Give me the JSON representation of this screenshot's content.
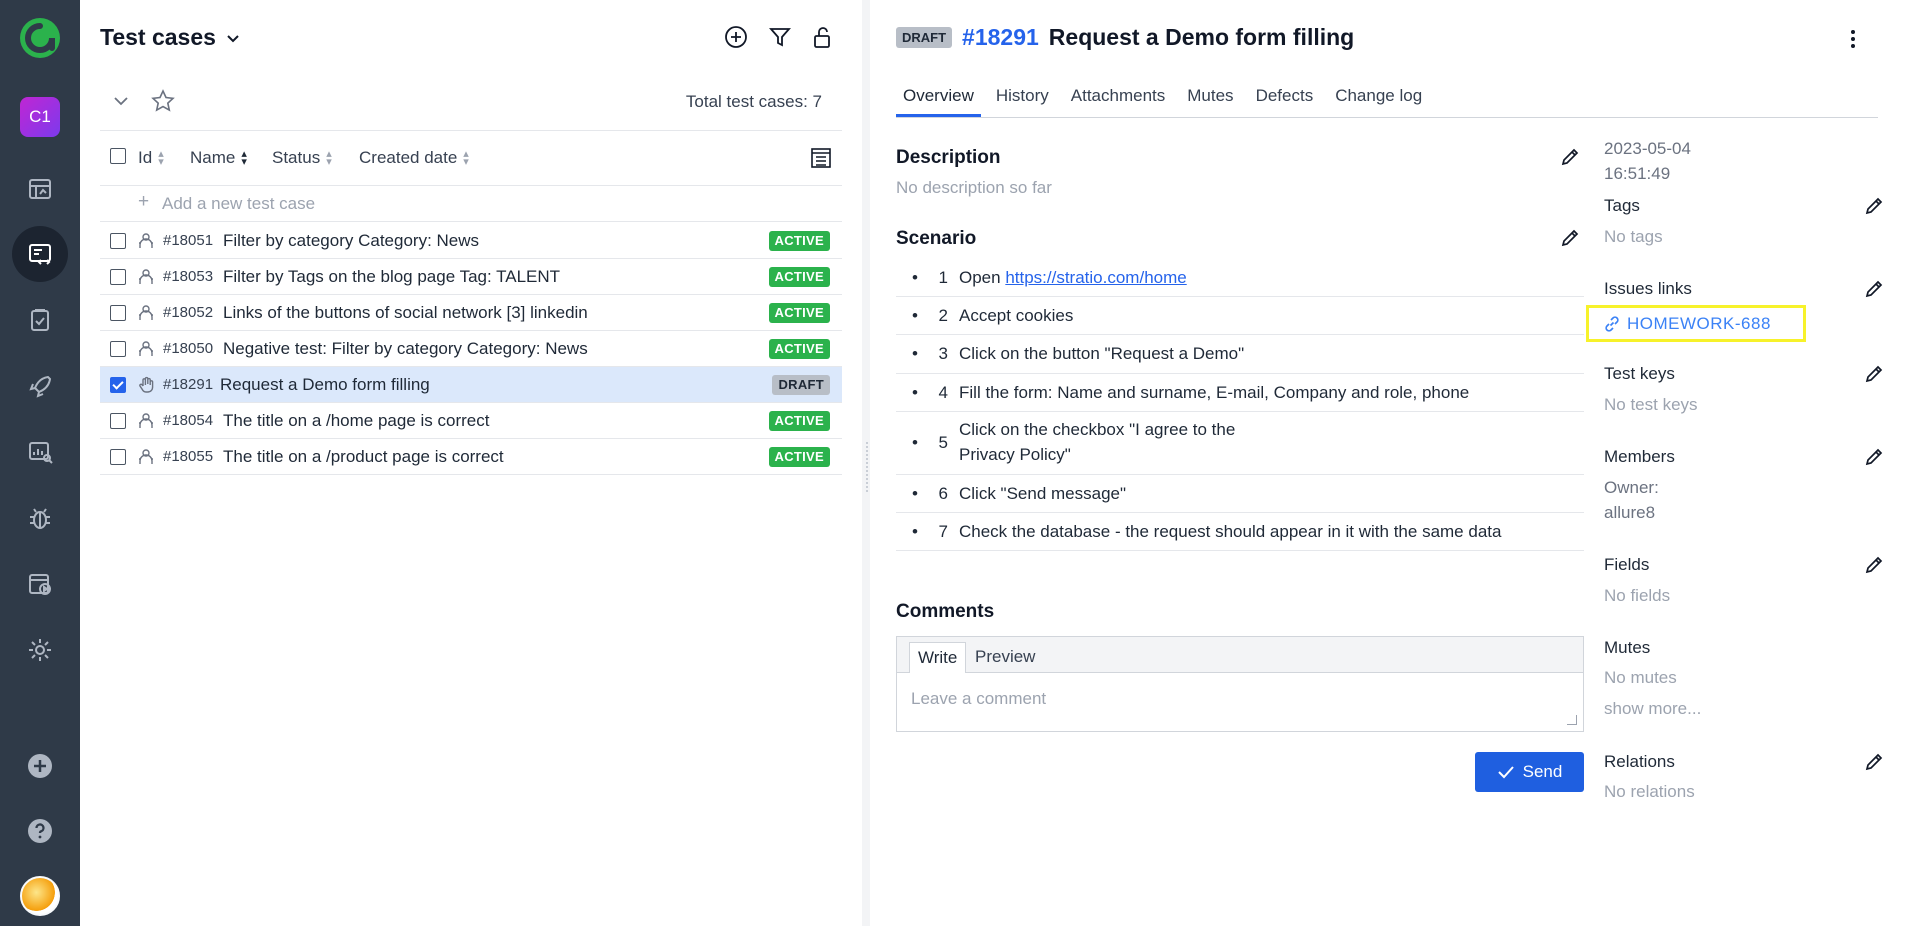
{
  "nav": {
    "project_initials": "C1",
    "items": [
      "dashboards-icon",
      "test-cases-icon",
      "test-plans-icon",
      "launches-icon",
      "analytics-icon",
      "defects-icon",
      "jobs-icon",
      "settings-icon"
    ],
    "bottom": [
      "add-icon",
      "help-icon",
      "avatar"
    ]
  },
  "list": {
    "title": "Test cases",
    "total": "Total test cases: 7",
    "columns": {
      "id": "Id",
      "name": "Name",
      "status": "Status",
      "created": "Created date"
    },
    "add_placeholder": "Add a new test case",
    "rows": [
      {
        "id": "#18051",
        "name": "Filter by category Category: News",
        "status": "ACTIVE",
        "selected": false
      },
      {
        "id": "#18053",
        "name": "Filter by Tags on the blog page Tag: TALENT",
        "status": "ACTIVE",
        "selected": false
      },
      {
        "id": "#18052",
        "name": "Links of the buttons of social network [3] linkedin",
        "status": "ACTIVE",
        "selected": false
      },
      {
        "id": "#18050",
        "name": "Negative test: Filter by category Category: News",
        "status": "ACTIVE",
        "selected": false
      },
      {
        "id": "#18291",
        "name": "Request a Demo form filling",
        "status": "DRAFT",
        "selected": true
      },
      {
        "id": "#18054",
        "name": "The title on a /home page is correct",
        "status": "ACTIVE",
        "selected": false
      },
      {
        "id": "#18055",
        "name": "The title on a /product page is correct",
        "status": "ACTIVE",
        "selected": false
      }
    ]
  },
  "detail": {
    "badge": "DRAFT",
    "number": "#18291",
    "title": "Request a Demo form filling",
    "tabs": [
      "Overview",
      "History",
      "Attachments",
      "Mutes",
      "Defects",
      "Change log"
    ],
    "active_tab": "Overview",
    "description_title": "Description",
    "description_empty": "No description so far",
    "scenario_title": "Scenario",
    "steps": [
      {
        "n": "1",
        "prefix": "Open ",
        "link": "https://stratio.com/home"
      },
      {
        "n": "2",
        "text": "Accept cookies"
      },
      {
        "n": "3",
        "text": "Click on the button \"Request a Demo\""
      },
      {
        "n": "4",
        "text": "Fill the form: Name and surname, E-mail, Company and role, phone"
      },
      {
        "n": "5",
        "text": "Click on the checkbox \"I agree to the",
        "text2": "Privacy Policy\""
      },
      {
        "n": "6",
        "text": "Click \"Send message\""
      },
      {
        "n": "7",
        "text": "Check the database - the request should appear in it with the same data"
      }
    ],
    "comments_title": "Comments",
    "comment_tabs": {
      "write": "Write",
      "preview": "Preview"
    },
    "comment_placeholder": "Leave a comment",
    "send_label": "Send"
  },
  "sidebar": {
    "date": "2023-05-04",
    "time": "16:51:49",
    "tags_title": "Tags",
    "tags_empty": "No tags",
    "issues_title": "Issues links",
    "issue_link": "HOMEWORK-688",
    "testkeys_title": "Test keys",
    "testkeys_empty": "No test keys",
    "members_title": "Members",
    "owner_label": "Owner:",
    "owner_value": "allure8",
    "fields_title": "Fields",
    "fields_empty": "No fields",
    "mutes_title": "Mutes",
    "mutes_empty": "No mutes",
    "show_more": "show more...",
    "relations_title": "Relations",
    "relations_empty": "No relations"
  },
  "colors": {
    "nav_bg": "#2f3a48",
    "accent": "#2563eb",
    "active_badge": "#2bb24c",
    "highlight": "#f7f22a",
    "selected_row": "#dbe8fb"
  }
}
